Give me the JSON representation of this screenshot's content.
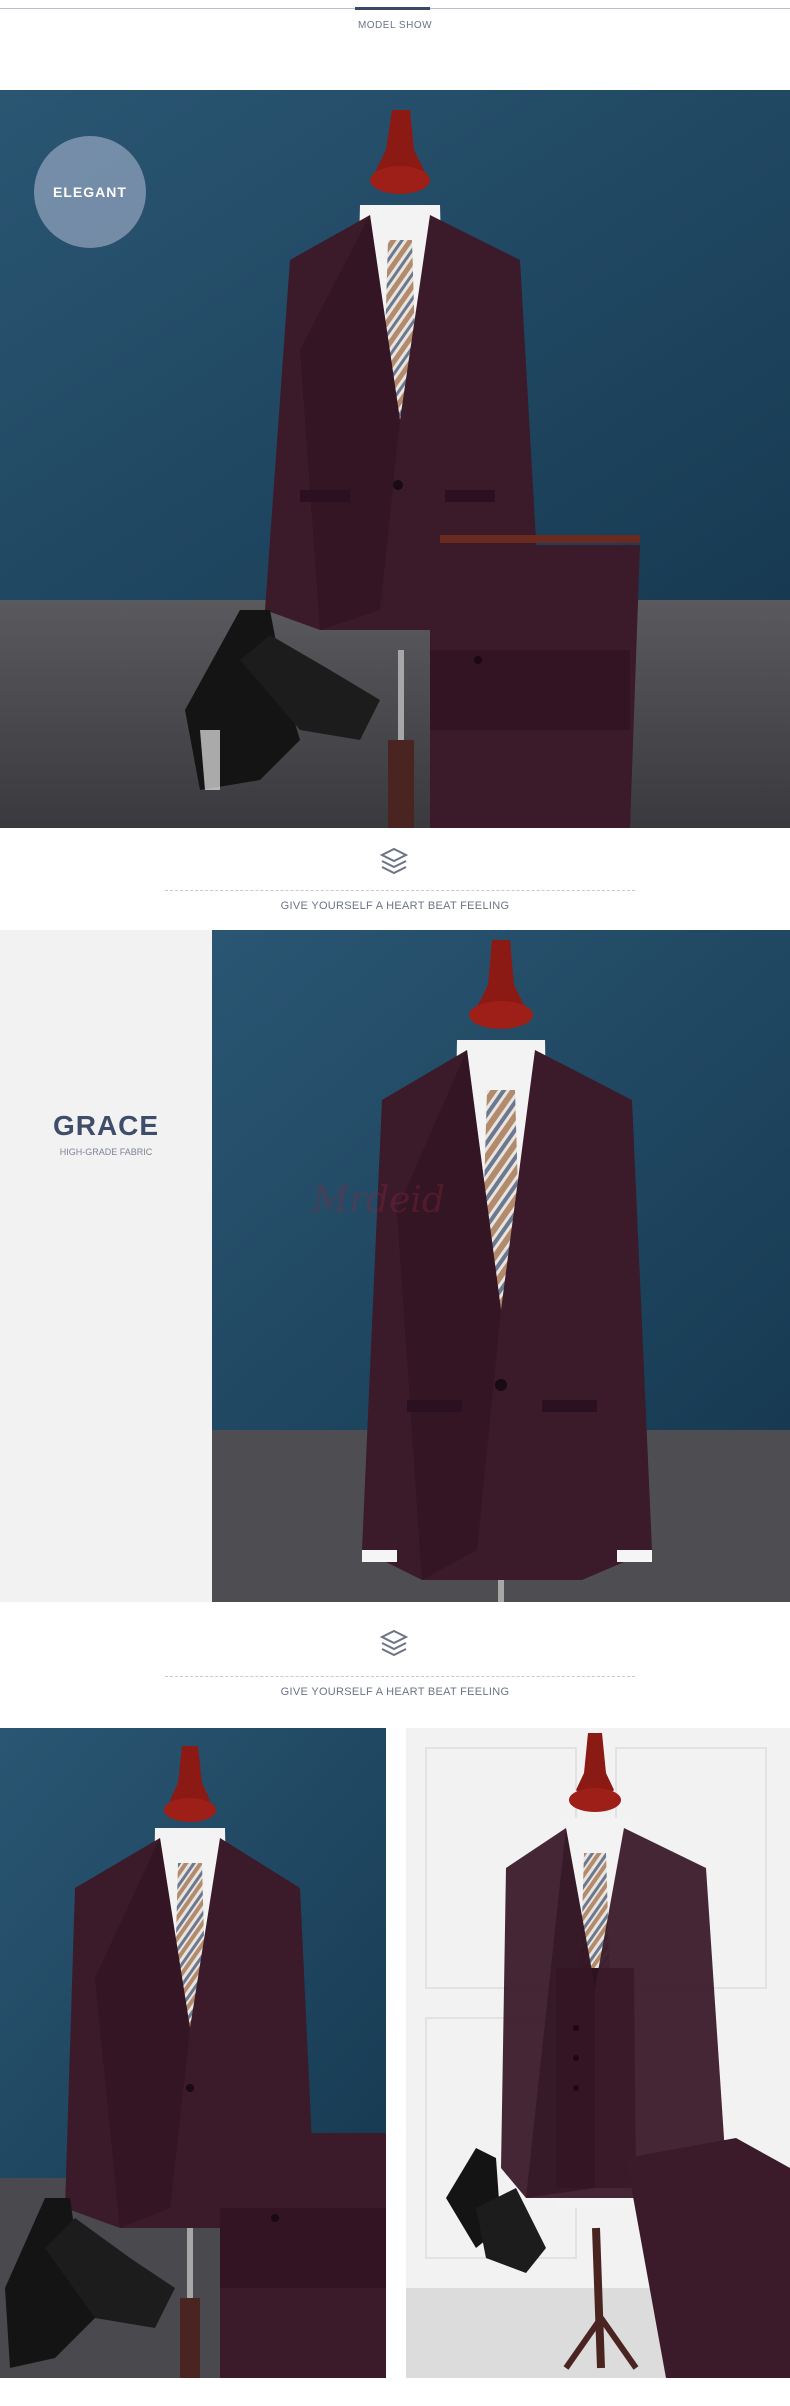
{
  "header": {
    "title": "MODEL SHOW"
  },
  "hero": {
    "badge": "ELEGANT",
    "alt": "Burgundy suit jacket and trousers on mannequin with patent shoes"
  },
  "divider1": {
    "slogan": "GIVE YOURSELF A HEART BEAT FEELING",
    "icon": "brand-logo-icon"
  },
  "grace": {
    "title": "GRACE",
    "subtitle": "HIGH-GRADE FABRIC",
    "watermark": "Mrdeid"
  },
  "divider2": {
    "slogan": "GIVE YOURSELF A HEART BEAT FEELING",
    "icon": "brand-logo-icon"
  },
  "colors": {
    "accent": "#3a4a66",
    "suit": "#3b1a2a",
    "backdrop": "#1f4660",
    "floor": "#4a4a4e"
  }
}
